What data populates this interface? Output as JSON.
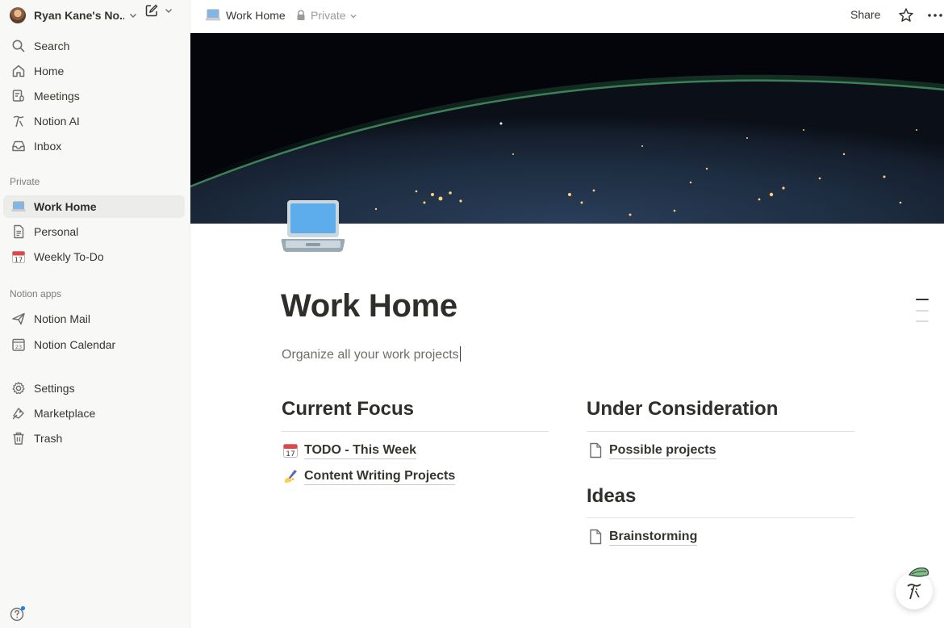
{
  "workspace": {
    "name": "Ryan Kane's No..."
  },
  "sidebar": {
    "nav": [
      {
        "label": "Search",
        "icon": "search-icon"
      },
      {
        "label": "Home",
        "icon": "home-icon"
      },
      {
        "label": "Meetings",
        "icon": "meetings-icon"
      },
      {
        "label": "Notion AI",
        "icon": "notion-ai-icon"
      },
      {
        "label": "Inbox",
        "icon": "inbox-icon"
      }
    ],
    "private_label": "Private",
    "private_pages": [
      {
        "label": "Work Home",
        "icon": "laptop-icon",
        "active": true
      },
      {
        "label": "Personal",
        "icon": "page-icon"
      },
      {
        "label": "Weekly To-Do",
        "icon": "calendar-icon"
      }
    ],
    "apps_label": "Notion apps",
    "apps": [
      {
        "label": "Notion Mail",
        "icon": "mail-icon"
      },
      {
        "label": "Notion Calendar",
        "icon": "calendar-app-icon"
      }
    ],
    "bottom": [
      {
        "label": "Settings",
        "icon": "gear-icon"
      },
      {
        "label": "Marketplace",
        "icon": "marketplace-icon"
      },
      {
        "label": "Trash",
        "icon": "trash-icon"
      }
    ]
  },
  "topbar": {
    "page_title": "Work Home",
    "visibility": "Private",
    "share_label": "Share"
  },
  "page": {
    "title": "Work Home",
    "description": "Organize all your work projects"
  },
  "sections": {
    "current_focus": {
      "heading": "Current Focus",
      "links": [
        {
          "label": "TODO - This Week",
          "icon": "calendar-icon"
        },
        {
          "label": "Content Writing Projects",
          "icon": "writing-hand-icon"
        }
      ]
    },
    "under_consideration": {
      "heading": "Under Consideration",
      "links": [
        {
          "label": "Possible projects",
          "icon": "page-icon"
        }
      ]
    },
    "ideas": {
      "heading": "Ideas",
      "links": [
        {
          "label": "Brainstorming",
          "icon": "page-icon"
        }
      ]
    }
  },
  "colors": {
    "sidebar_bg": "#f8f8f7",
    "text": "#37352f",
    "muted": "#9b9a97",
    "active_bg": "#ececeb",
    "notification_dot": "#2383e2"
  }
}
